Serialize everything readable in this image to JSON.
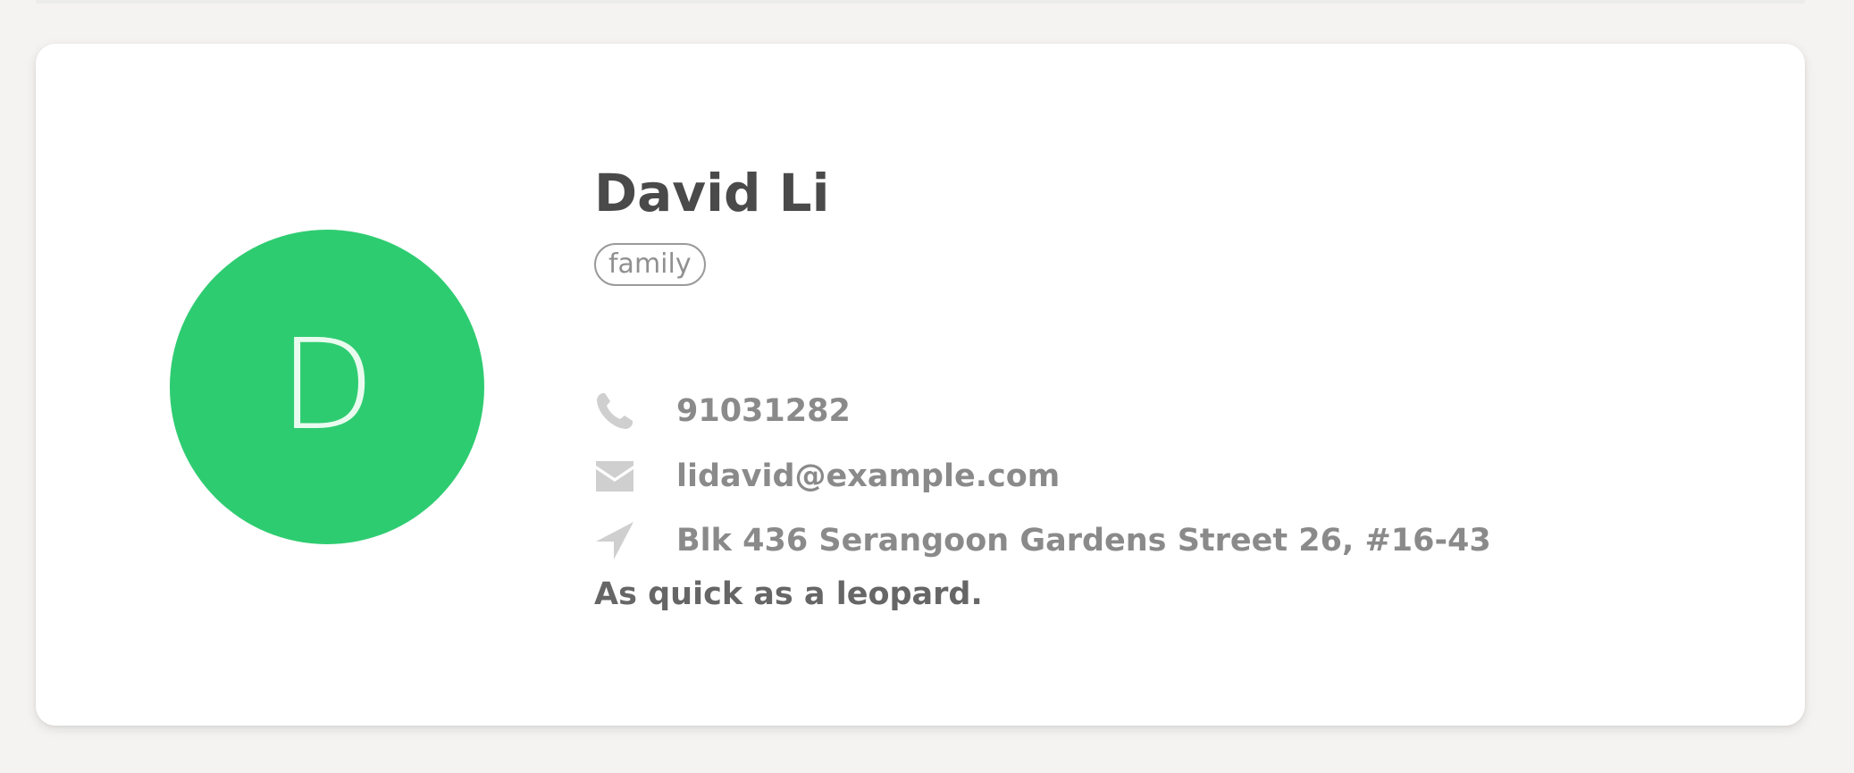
{
  "contact": {
    "avatar_letter": "D",
    "avatar_color": "#2ecc71",
    "name": "David Li",
    "tag": "family",
    "phone": {
      "icon": "phone-icon",
      "value": "91031282"
    },
    "email": {
      "icon": "envelope-icon",
      "value": "lidavid@example.com"
    },
    "address": {
      "icon": "location-arrow-icon",
      "value": "Blk 436 Serangoon Gardens Street 26, #16-43"
    },
    "bio": "As quick as a leopard."
  }
}
